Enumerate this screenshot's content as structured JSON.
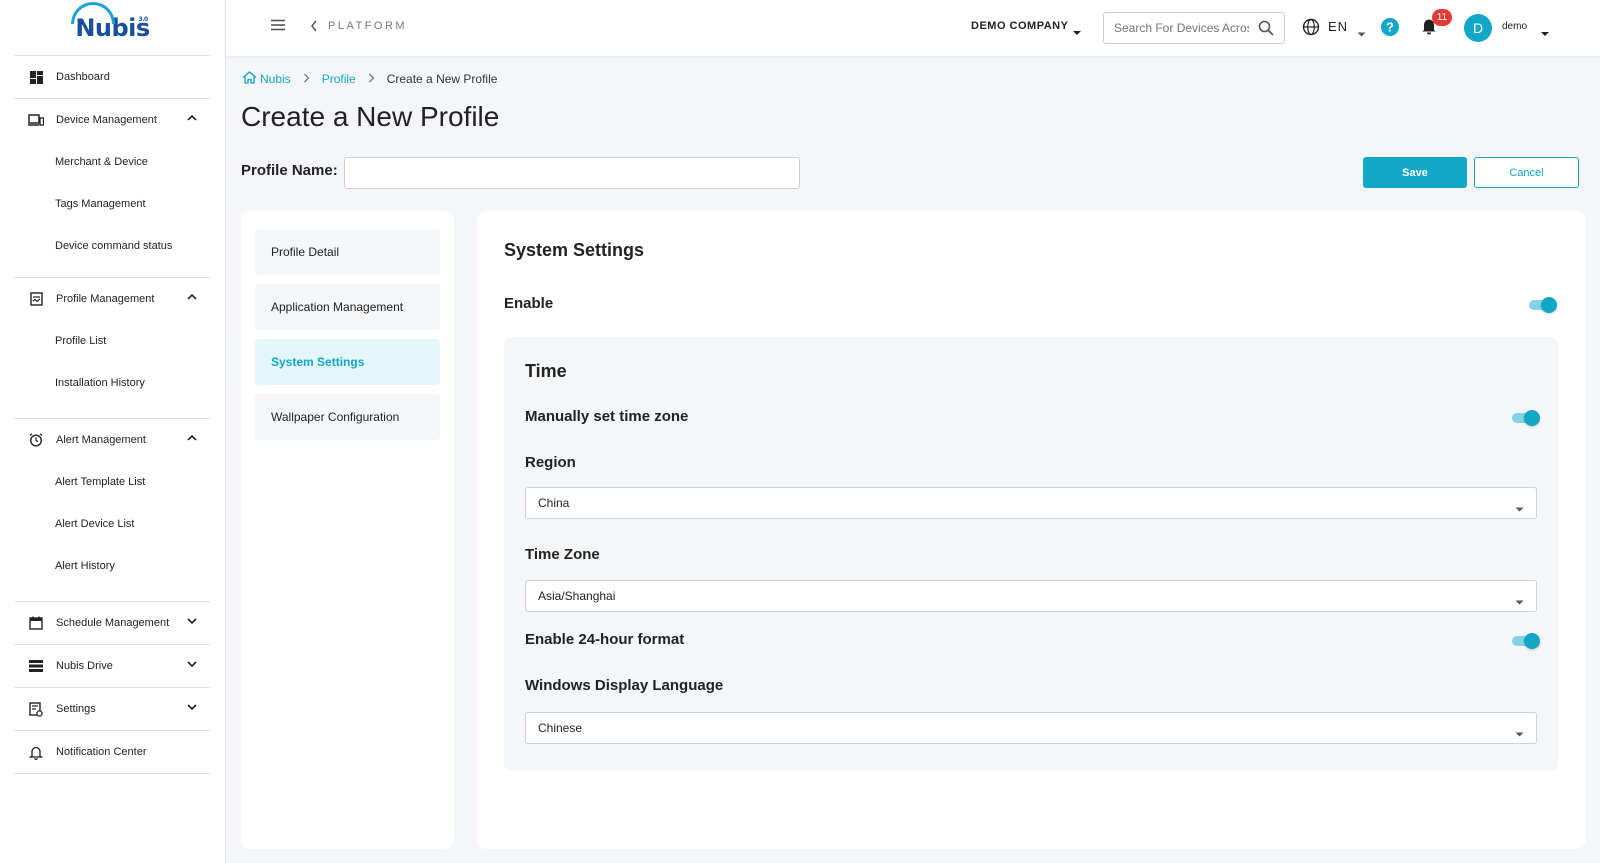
{
  "brand": {
    "name": "Nubis",
    "version": "3.0"
  },
  "sidebar": {
    "groups": [
      {
        "label": "Dashboard",
        "icon": "dashboard-icon",
        "children": []
      },
      {
        "label": "Device Management",
        "icon": "devices-icon",
        "expanded": true,
        "children": [
          "Merchant & Device",
          "Tags Management",
          "Device command status"
        ]
      },
      {
        "label": "Profile Management",
        "icon": "profile-icon",
        "expanded": true,
        "children": [
          "Profile List",
          "Installation History"
        ]
      },
      {
        "label": "Alert Management",
        "icon": "alarm-icon",
        "expanded": true,
        "children": [
          "Alert Template List",
          "Alert Device List",
          "Alert History"
        ]
      },
      {
        "label": "Schedule Management",
        "icon": "calendar-icon",
        "expanded": false,
        "children": []
      },
      {
        "label": "Nubis Drive",
        "icon": "drive-icon",
        "expanded": false,
        "children": []
      },
      {
        "label": "Settings",
        "icon": "settings-icon",
        "expanded": false,
        "children": []
      },
      {
        "label": "Notification Center",
        "icon": "bell-icon",
        "children": []
      }
    ]
  },
  "header": {
    "platform": "PLATFORM",
    "company": "DEMO COMPANY",
    "search_placeholder": "Search For Devices Across",
    "language": "EN",
    "notification_count": "11",
    "avatar_initial": "D",
    "username": "demo"
  },
  "breadcrumb": {
    "home": "Nubis",
    "parent": "Profile",
    "current": "Create a New Profile"
  },
  "page": {
    "title": "Create a New Profile",
    "profile_name_label": "Profile Name:",
    "profile_name_value": "",
    "save_label": "Save",
    "cancel_label": "Cancel"
  },
  "profile_tabs": [
    {
      "label": "Profile Detail",
      "active": false
    },
    {
      "label": "Application Management",
      "active": false
    },
    {
      "label": "System Settings",
      "active": true
    },
    {
      "label": "Wallpaper Configuration",
      "active": false
    }
  ],
  "system_settings": {
    "title": "System Settings",
    "enable_label": "Enable",
    "enabled": true,
    "time": {
      "title": "Time",
      "manual_tz_label": "Manually set time zone",
      "manual_tz_enabled": true,
      "region_label": "Region",
      "region_value": "China",
      "timezone_label": "Time Zone",
      "timezone_value": "Asia/Shanghai",
      "hour24_label": "Enable 24-hour format",
      "hour24_enabled": true,
      "language_label": "Windows Display Language",
      "language_value": "Chinese"
    }
  },
  "colors": {
    "accent": "#12a6c8",
    "badge": "#e53935",
    "brand": "#1a4f9c"
  }
}
